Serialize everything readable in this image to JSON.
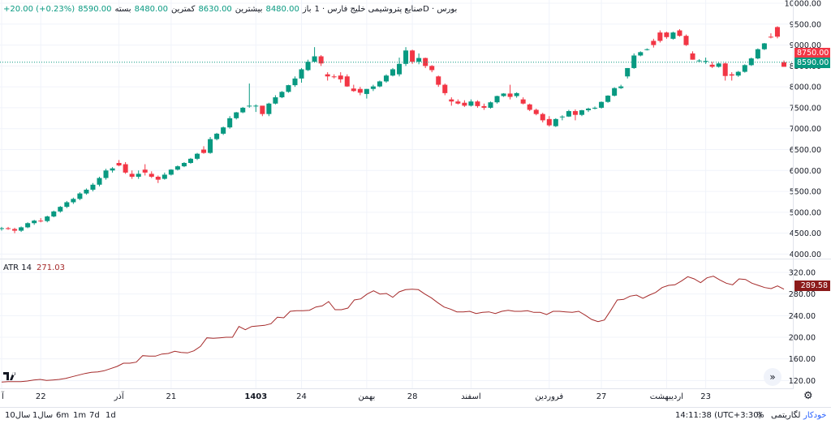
{
  "legend": {
    "symbol": "صنایع پتروشیمی خلیج فارس · 1D · بورس",
    "open_label": "باز",
    "open": "8480.00",
    "high_label": "بیشترین",
    "high": "8630.00",
    "low_label": "کمترین",
    "low": "8480.00",
    "close_label": "بسته",
    "close": "8590.00",
    "change": "+20.00 (+0.23%)"
  },
  "atr_legend": {
    "name": "ATR 14",
    "value": "271.03"
  },
  "price_tags": {
    "upper": "8750.00",
    "lower": "8590.00"
  },
  "atr_tag": "289.58",
  "bottom": {
    "timeframes": [
      "1d",
      "7d",
      "1m",
      "6m",
      "1سال",
      "10سال"
    ],
    "clock": "14:11:38 (UTC+3:30)",
    "percent": "%",
    "log": "لگاریتمی",
    "auto": "خودکار"
  },
  "icons": {
    "logo": "tradingview-logo-icon",
    "goto": "scroll-to-realtime-icon",
    "settings": "gear-icon"
  },
  "colors": {
    "up": "#089981",
    "down": "#f23645",
    "atr": "#a52a2a",
    "grid": "#f0f3fa"
  },
  "chart_data": [
    {
      "type": "candlestick",
      "title": "صنایع پتروشیمی خلیج فارس",
      "y_ticks": [
        4000,
        4500,
        5000,
        5500,
        6000,
        6500,
        7000,
        7500,
        8000,
        8500,
        9000,
        9500,
        10000
      ],
      "ylim": [
        3950,
        10000
      ],
      "x_labels": [
        "آ",
        "22",
        "آذر",
        "21",
        "1403",
        "24",
        "بهمن",
        "28",
        "اسفند",
        "فروردین",
        "27",
        "اردیبهشت",
        "23"
      ],
      "ohlc": [
        [
          4600,
          4650,
          4560,
          4620
        ],
        [
          4620,
          4650,
          4580,
          4600
        ],
        [
          4600,
          4630,
          4500,
          4560
        ],
        [
          4560,
          4660,
          4530,
          4640
        ],
        [
          4640,
          4760,
          4620,
          4740
        ],
        [
          4740,
          4820,
          4700,
          4800
        ],
        [
          4800,
          4860,
          4760,
          4790
        ],
        [
          4790,
          4920,
          4760,
          4900
        ],
        [
          4900,
          5040,
          4880,
          5020
        ],
        [
          5020,
          5150,
          4990,
          5130
        ],
        [
          5130,
          5270,
          5100,
          5240
        ],
        [
          5240,
          5350,
          5200,
          5320
        ],
        [
          5320,
          5480,
          5290,
          5450
        ],
        [
          5450,
          5570,
          5420,
          5540
        ],
        [
          5540,
          5700,
          5500,
          5660
        ],
        [
          5660,
          5850,
          5620,
          5820
        ],
        [
          5820,
          6040,
          5780,
          6000
        ],
        [
          6000,
          6080,
          5950,
          6050
        ],
        [
          6180,
          6250,
          6100,
          6120
        ],
        [
          6150,
          6200,
          5920,
          5950
        ],
        [
          5920,
          6000,
          5800,
          5850
        ],
        [
          5850,
          6000,
          5800,
          5920
        ],
        [
          6020,
          6150,
          5880,
          5950
        ],
        [
          5920,
          5980,
          5820,
          5850
        ],
        [
          5850,
          5880,
          5700,
          5780
        ],
        [
          5800,
          5950,
          5780,
          5900
        ],
        [
          5900,
          6030,
          5880,
          6020
        ],
        [
          6020,
          6120,
          6000,
          6100
        ],
        [
          6100,
          6200,
          6080,
          6180
        ],
        [
          6180,
          6300,
          6160,
          6280
        ],
        [
          6280,
          6420,
          6250,
          6400
        ],
        [
          6500,
          6580,
          6400,
          6420
        ],
        [
          6420,
          6800,
          6400,
          6750
        ],
        [
          6750,
          6900,
          6720,
          6880
        ],
        [
          6880,
          7050,
          6850,
          7030
        ],
        [
          7030,
          7300,
          7000,
          7250
        ],
        [
          7250,
          7400,
          7220,
          7390
        ],
        [
          7390,
          7520,
          7370,
          7500
        ],
        [
          7550,
          8080,
          7500,
          7550
        ],
        [
          7550,
          7580,
          7400,
          7550
        ],
        [
          7550,
          7500,
          7300,
          7350
        ],
        [
          7350,
          7620,
          7300,
          7600
        ],
        [
          7600,
          7800,
          7580,
          7750
        ],
        [
          7750,
          7900,
          7730,
          7880
        ],
        [
          7880,
          8050,
          7860,
          8040
        ],
        [
          8040,
          8250,
          8000,
          8200
        ],
        [
          8200,
          8450,
          8100,
          8420
        ],
        [
          8400,
          8650,
          8380,
          8600
        ],
        [
          8600,
          8950,
          8580,
          8730
        ],
        [
          8730,
          8760,
          8500,
          8560
        ],
        [
          8300,
          8350,
          8150,
          8250
        ],
        [
          8250,
          8300,
          8200,
          8230
        ],
        [
          8270,
          8350,
          8100,
          8180
        ],
        [
          8250,
          8300,
          8000,
          8010
        ],
        [
          7960,
          8050,
          7880,
          7900
        ],
        [
          7950,
          8000,
          7800,
          7860
        ],
        [
          7830,
          7950,
          7720,
          7950
        ],
        [
          7950,
          8050,
          7900,
          8010
        ],
        [
          8010,
          8150,
          7990,
          8130
        ],
        [
          8130,
          8300,
          8100,
          8270
        ],
        [
          8270,
          8450,
          8250,
          8420
        ],
        [
          8300,
          8700,
          8250,
          8550
        ],
        [
          8550,
          8950,
          8500,
          8870
        ],
        [
          8870,
          8890,
          8550,
          8600
        ],
        [
          8600,
          8800,
          8540,
          8690
        ],
        [
          8690,
          8700,
          8450,
          8500
        ],
        [
          8500,
          8520,
          8350,
          8400
        ],
        [
          8250,
          8270,
          8000,
          8050
        ],
        [
          8050,
          8080,
          7800,
          7850
        ],
        [
          7700,
          7750,
          7550,
          7650
        ],
        [
          7650,
          7700,
          7580,
          7600
        ],
        [
          7620,
          7680,
          7520,
          7550
        ],
        [
          7550,
          7700,
          7530,
          7650
        ],
        [
          7650,
          7680,
          7500,
          7540
        ],
        [
          7540,
          7600,
          7450,
          7500
        ],
        [
          7500,
          7650,
          7480,
          7630
        ],
        [
          7630,
          7790,
          7600,
          7780
        ],
        [
          7780,
          7850,
          7760,
          7840
        ],
        [
          7840,
          8050,
          7700,
          7760
        ],
        [
          7780,
          7870,
          7740,
          7850
        ],
        [
          7700,
          7750,
          7580,
          7600
        ],
        [
          7580,
          7600,
          7420,
          7450
        ],
        [
          7450,
          7480,
          7320,
          7350
        ],
        [
          7350,
          7380,
          7150,
          7200
        ],
        [
          7230,
          7300,
          7050,
          7080
        ],
        [
          7060,
          7250,
          7040,
          7230
        ],
        [
          7280,
          7320,
          7200,
          7290
        ],
        [
          7290,
          7450,
          7280,
          7420
        ],
        [
          7420,
          7460,
          7200,
          7330
        ],
        [
          7330,
          7450,
          7300,
          7440
        ],
        [
          7440,
          7500,
          7400,
          7480
        ],
        [
          7480,
          7530,
          7460,
          7500
        ],
        [
          7500,
          7650,
          7480,
          7640
        ],
        [
          7640,
          7800,
          7620,
          7790
        ],
        [
          7790,
          7990,
          7770,
          7970
        ],
        [
          7970,
          8050,
          7950,
          8010
        ],
        [
          8250,
          8450,
          8200,
          8450
        ],
        [
          8450,
          8800,
          8430,
          8750
        ],
        [
          8750,
          8850,
          8730,
          8830
        ],
        [
          8890,
          8920,
          8870,
          8900
        ],
        [
          9100,
          9150,
          8940,
          9000
        ],
        [
          9300,
          9350,
          9060,
          9100
        ],
        [
          9300,
          9320,
          9150,
          9190
        ],
        [
          9150,
          9320,
          9130,
          9300
        ],
        [
          9350,
          9380,
          9200,
          9220
        ],
        [
          9220,
          9250,
          8980,
          9000
        ],
        [
          8800,
          8850,
          8650,
          8650
        ],
        [
          8620,
          8660,
          8600,
          8630
        ],
        [
          8600,
          8700,
          8550,
          8620
        ],
        [
          8530,
          8600,
          8450,
          8480
        ],
        [
          8480,
          8580,
          8460,
          8560
        ],
        [
          8560,
          8580,
          8150,
          8260
        ],
        [
          8300,
          8350,
          8150,
          8270
        ],
        [
          8270,
          8380,
          8240,
          8360
        ],
        [
          8360,
          8540,
          8340,
          8520
        ],
        [
          8520,
          8700,
          8500,
          8680
        ],
        [
          8680,
          8920,
          8660,
          8900
        ],
        [
          8900,
          9050,
          8880,
          9040
        ],
        [
          9200,
          9280,
          9160,
          9180
        ],
        [
          9430,
          9450,
          9160,
          9200
        ],
        [
          8590,
          8630,
          8480,
          8480
        ]
      ],
      "last_close": 8590,
      "upper_line": 8750
    },
    {
      "type": "line",
      "series": [
        {
          "name": "ATR 14"
        }
      ],
      "y_ticks": [
        120,
        160,
        200,
        240,
        280,
        320
      ],
      "ylim": [
        110,
        335
      ],
      "values": [
        117,
        118,
        118,
        118,
        119,
        121,
        122,
        120,
        121,
        122,
        124,
        127,
        130,
        133,
        135,
        136,
        138,
        142,
        146,
        152,
        152,
        154,
        166,
        165,
        165,
        169,
        170,
        174,
        172,
        171,
        175,
        183,
        199,
        198,
        199,
        200,
        200,
        220,
        214,
        220,
        221,
        222,
        225,
        237,
        236,
        248,
        249,
        249,
        250,
        256,
        258,
        266,
        251,
        251,
        254,
        269,
        271,
        280,
        286,
        280,
        281,
        274,
        284,
        288,
        289,
        288,
        280,
        273,
        264,
        256,
        252,
        247,
        247,
        248,
        244,
        246,
        247,
        244,
        248,
        250,
        248,
        248,
        249,
        246,
        246,
        242,
        248,
        248,
        247,
        246,
        248,
        241,
        233,
        229,
        232,
        250,
        269,
        270,
        276,
        278,
        272,
        278,
        283,
        292,
        296,
        297,
        304,
        312,
        308,
        301,
        310,
        313,
        306,
        300,
        297,
        308,
        307,
        300,
        296,
        292,
        290,
        295,
        289
      ],
      "last_value": 289.58
    }
  ]
}
